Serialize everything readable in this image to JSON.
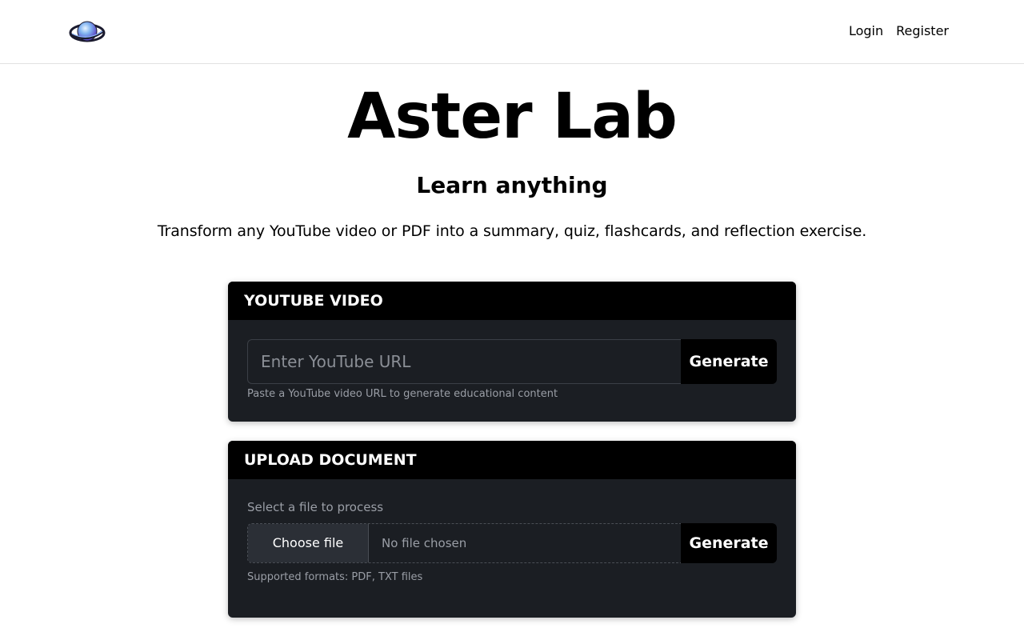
{
  "nav": {
    "logo_icon": "planet-logo-icon",
    "links": [
      {
        "label": "Login"
      },
      {
        "label": "Register"
      }
    ]
  },
  "hero": {
    "title": "Aster Lab",
    "subtitle": "Learn anything",
    "description": "Transform any YouTube video or PDF into a summary, quiz, flashcards, and reflection exercise."
  },
  "youtube_card": {
    "header": "YOUTUBE VIDEO",
    "url_placeholder": "Enter YouTube URL",
    "url_value": "",
    "generate_label": "Generate",
    "helper": "Paste a YouTube video URL to generate educational content"
  },
  "document_card": {
    "header": "UPLOAD DOCUMENT",
    "select_label": "Select a file to process",
    "choose_file_label": "Choose file",
    "file_status": "No file chosen",
    "generate_label": "Generate",
    "helper": "Supported formats: PDF, TXT files"
  },
  "colors": {
    "card_background": "#1b1e23",
    "card_header": "#000000",
    "helper_text": "#9a9ea6"
  }
}
